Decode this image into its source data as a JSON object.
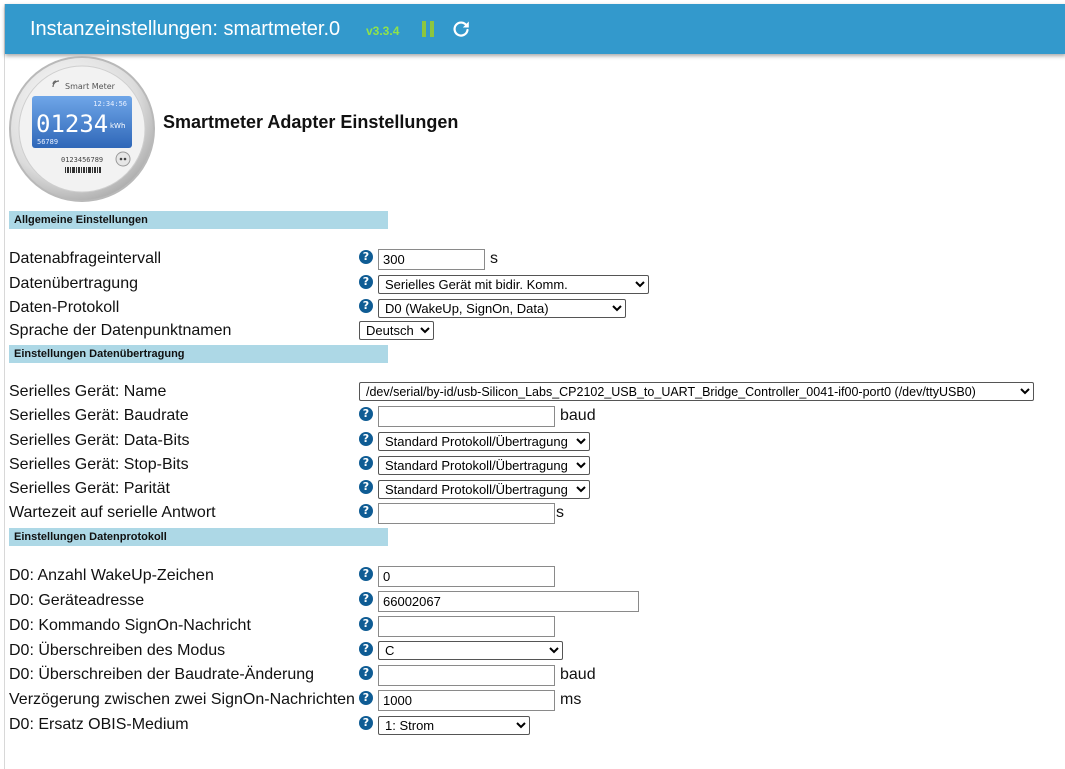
{
  "header": {
    "title": "Instanzeinstellungen: smartmeter.0",
    "version": "v3.3.4"
  },
  "colors": {
    "header_bg": "#3399cc",
    "section_bg": "#add8e6",
    "version": "#8fe34a",
    "help": "#0f5c94"
  },
  "hero": {
    "brand": "Smart Meter",
    "time": "12:34:56",
    "reading": "01234",
    "unit": "kWh",
    "small": "56789",
    "serial": "0123456789",
    "heading": "Smartmeter Adapter Einstellungen"
  },
  "sections": {
    "general": "Allgemeine Einstellungen",
    "transfer": "Einstellungen Datenübertragung",
    "protocol": "Einstellungen Datenprotokoll"
  },
  "fields": {
    "interval": {
      "label": "Datenabfrageintervall",
      "value": "300",
      "unit": "s"
    },
    "transfer": {
      "label": "Datenübertragung",
      "value": "Serielles Gerät mit bidir. Komm."
    },
    "protocol": {
      "label": "Daten-Protokoll",
      "value": "D0 (WakeUp, SignOn, Data)"
    },
    "language": {
      "label": "Sprache der Datenpunktnamen",
      "value": "Deutsch"
    },
    "serial_name": {
      "label": "Serielles Gerät: Name",
      "value": "/dev/serial/by-id/usb-Silicon_Labs_CP2102_USB_to_UART_Bridge_Controller_0041-if00-port0 (/dev/ttyUSB0)"
    },
    "baudrate": {
      "label": "Serielles Gerät: Baudrate",
      "value": "",
      "unit": "baud"
    },
    "databits": {
      "label": "Serielles Gerät: Data-Bits",
      "value": "Standard Protokoll/Übertragung"
    },
    "stopbits": {
      "label": "Serielles Gerät: Stop-Bits",
      "value": "Standard Protokoll/Übertragung"
    },
    "parity": {
      "label": "Serielles Gerät: Parität",
      "value": "Standard Protokoll/Übertragung"
    },
    "wait": {
      "label": "Wartezeit auf serielle Antwort",
      "value": "",
      "unit": "s"
    },
    "wakeup": {
      "label": "D0: Anzahl WakeUp-Zeichen",
      "value": "0"
    },
    "address": {
      "label": "D0: Geräteadresse",
      "value": "66002067"
    },
    "signon": {
      "label": "D0: Kommando SignOn-Nachricht",
      "value": ""
    },
    "mode": {
      "label": "D0: Überschreiben des Modus",
      "value": "C"
    },
    "baudchange": {
      "label": "D0: Überschreiben der Baudrate-Änderung",
      "value": "",
      "unit": "baud"
    },
    "delay": {
      "label": "Verzögerung zwischen zwei SignOn-Nachrichten",
      "value": "1000",
      "unit": "ms"
    },
    "obis": {
      "label": "D0: Ersatz OBIS-Medium",
      "value": "1: Strom"
    }
  }
}
